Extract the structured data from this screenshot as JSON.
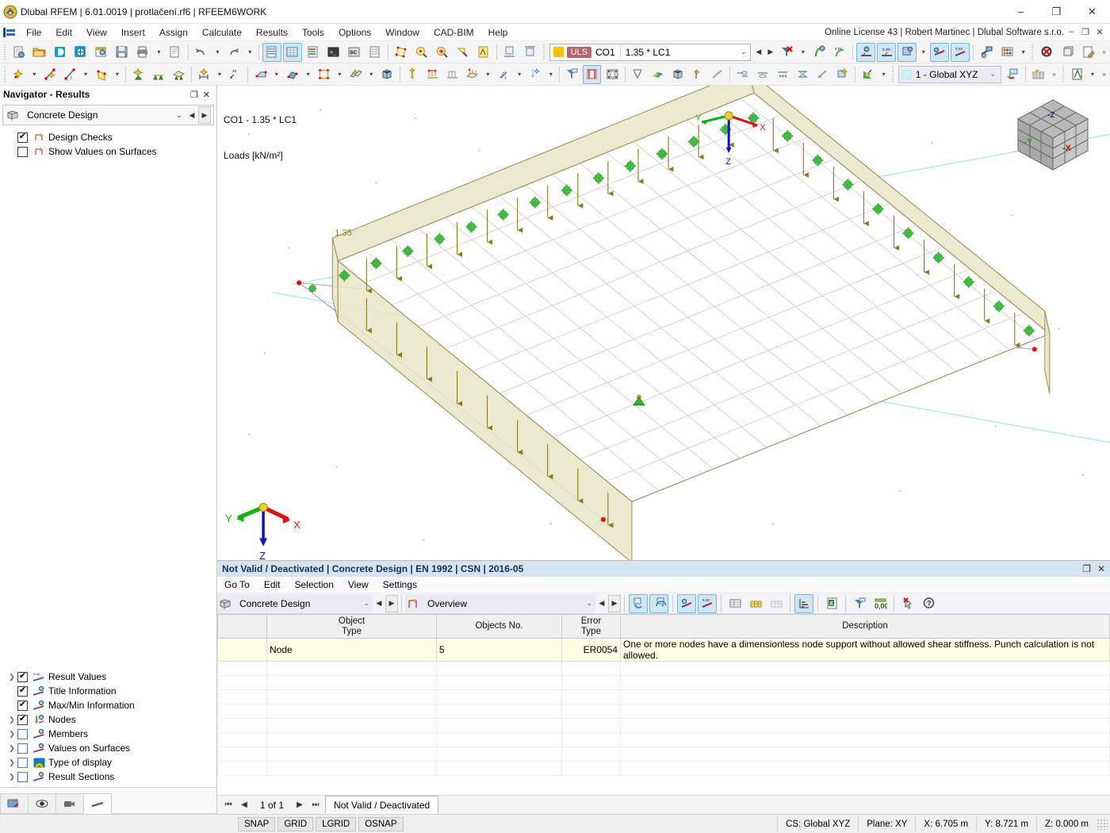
{
  "window": {
    "title": "Dlubal RFEM | 6.01.0019 | protlačení.rf6 | RFEEM6WORK",
    "app_icon": "rfem-logo-icon",
    "minimize": "–",
    "maximize": "❐",
    "close": "✕"
  },
  "menubar": {
    "items": [
      {
        "label": "File"
      },
      {
        "label": "Edit"
      },
      {
        "label": "View"
      },
      {
        "label": "Insert"
      },
      {
        "label": "Assign"
      },
      {
        "label": "Calculate"
      },
      {
        "label": "Results"
      },
      {
        "label": "Tools"
      },
      {
        "label": "Options"
      },
      {
        "label": "Window"
      },
      {
        "label": "CAD-BIM"
      },
      {
        "label": "Help"
      }
    ],
    "license": "Online License 43 | Robert Martinec | Dlubal Software s.r.o.",
    "mdi_minimize": "–",
    "mdi_restore": "❐",
    "mdi_close": "✕"
  },
  "toolbar_lc": {
    "badge": "ULS",
    "case": "CO1",
    "expression": "1.35 * LC1",
    "dropdown_arrow": "⌄",
    "prev": "◀",
    "next": "▶"
  },
  "toolbar_cs": {
    "value": "1 - Global XYZ",
    "dropdown_arrow": "⌄"
  },
  "navigator": {
    "title": "Navigator - Results",
    "float_icon": "❐",
    "close_icon": "✕",
    "selector": {
      "icon": "concrete-slab-icon",
      "label": "Concrete Design",
      "dropdown_arrow": "⌄",
      "prev": "◀",
      "next": "▶"
    },
    "top_items": [
      {
        "label": "Design Checks",
        "checked": true,
        "icon": "design-check-icon",
        "expandable": false
      },
      {
        "label": "Show Values on Surfaces",
        "checked": false,
        "icon": "design-check-icon",
        "expandable": false
      }
    ],
    "bottom_items": [
      {
        "label": "Result Values",
        "checked": true,
        "icon": "result-values-icon",
        "expandable": true
      },
      {
        "label": "Title Information",
        "checked": true,
        "icon": "title-info-icon",
        "expandable": false
      },
      {
        "label": "Max/Min Information",
        "checked": true,
        "icon": "maxmin-info-icon",
        "expandable": false
      },
      {
        "label": "Nodes",
        "checked": true,
        "icon": "nodes-icon",
        "expandable": true
      },
      {
        "label": "Members",
        "checked": false,
        "icon": "members-icon",
        "expandable": true
      },
      {
        "label": "Values on Surfaces",
        "checked": false,
        "icon": "values-surfaces-icon",
        "expandable": true
      },
      {
        "label": "Type of display",
        "checked": false,
        "icon": "rainbow-display-icon",
        "expandable": true
      },
      {
        "label": "Result Sections",
        "checked": false,
        "icon": "result-sections-icon",
        "expandable": true
      }
    ],
    "footer_tabs": [
      {
        "icon": "project-navigator-icon",
        "selected": false
      },
      {
        "icon": "display-navigator-icon",
        "selected": false
      },
      {
        "icon": "views-navigator-icon",
        "selected": false
      },
      {
        "icon": "results-navigator-icon",
        "selected": true
      }
    ],
    "checkmark": "✔"
  },
  "viewport": {
    "title_line1": "CO1 - 1.35 * LC1",
    "title_line2": "Loads [kN/m²]",
    "load_label": "1.35",
    "axes": {
      "x": "X",
      "y": "Y",
      "z": "Z"
    },
    "viewcube": {
      "top": "-Z",
      "left": "-Y",
      "right": "-X"
    }
  },
  "table_panel": {
    "header": "Not Valid / Deactivated | Concrete Design | EN 1992 | CSN | 2016-05",
    "float_icon": "❐",
    "close_icon": "✕",
    "menus": [
      {
        "label": "Go To"
      },
      {
        "label": "Edit"
      },
      {
        "label": "Selection"
      },
      {
        "label": "View"
      },
      {
        "label": "Settings"
      }
    ],
    "combo_left": {
      "icon": "concrete-slab-icon",
      "label": "Concrete Design",
      "dropdown_arrow": "⌄",
      "prev": "◀",
      "next": "▶"
    },
    "combo_right": {
      "icon": "overview-icon",
      "label": "Overview",
      "dropdown_arrow": "⌄",
      "prev": "◀",
      "next": "▶"
    },
    "columns": [
      {
        "label": "Object\nType",
        "key": "object_type"
      },
      {
        "label": "Objects No.",
        "key": "objects_no"
      },
      {
        "label": "Error\nType",
        "key": "error_type"
      },
      {
        "label": "Description",
        "key": "description"
      }
    ],
    "column_labels": {
      "object_type_l1": "Object",
      "object_type_l2": "Type",
      "objects_no": "Objects No.",
      "error_type_l1": "Error",
      "error_type_l2": "Type",
      "description": "Description"
    },
    "rows": [
      {
        "object_type": "Node",
        "objects_no": "5",
        "error_type": "ER0054",
        "description": "One or more nodes have a dimensionless node support without allowed shear stiffness. Punch calculation is not allowed."
      }
    ],
    "pager": {
      "first": "⏮",
      "prev": "◀",
      "label": "1 of 1",
      "next": "▶",
      "last": "⏭"
    },
    "tab_label": "Not Valid / Deactivated"
  },
  "statusbar": {
    "toggles": [
      {
        "label": "SNAP",
        "active": false
      },
      {
        "label": "GRID",
        "active": false
      },
      {
        "label": "LGRID",
        "active": false
      },
      {
        "label": "OSNAP",
        "active": false
      }
    ],
    "cells": [
      {
        "label": "CS: Global XYZ"
      },
      {
        "label": "Plane: XY"
      },
      {
        "label": "X: 6.705 m"
      },
      {
        "label": "Y: 8.721 m"
      },
      {
        "label": "Z: 0.000 m"
      }
    ]
  },
  "colors": {
    "accent_blue": "#3b7dd8",
    "title_panel_bg": "#d6e4f2",
    "error_red": "#e81123",
    "uls_badge": "#b4646b",
    "load_yellow": "#ffc000",
    "support_green": "#2db52d",
    "slab_fill": "#e8e6c8",
    "axis_x": "#e00000",
    "axis_y": "#00a000",
    "axis_z": "#0000c0"
  }
}
